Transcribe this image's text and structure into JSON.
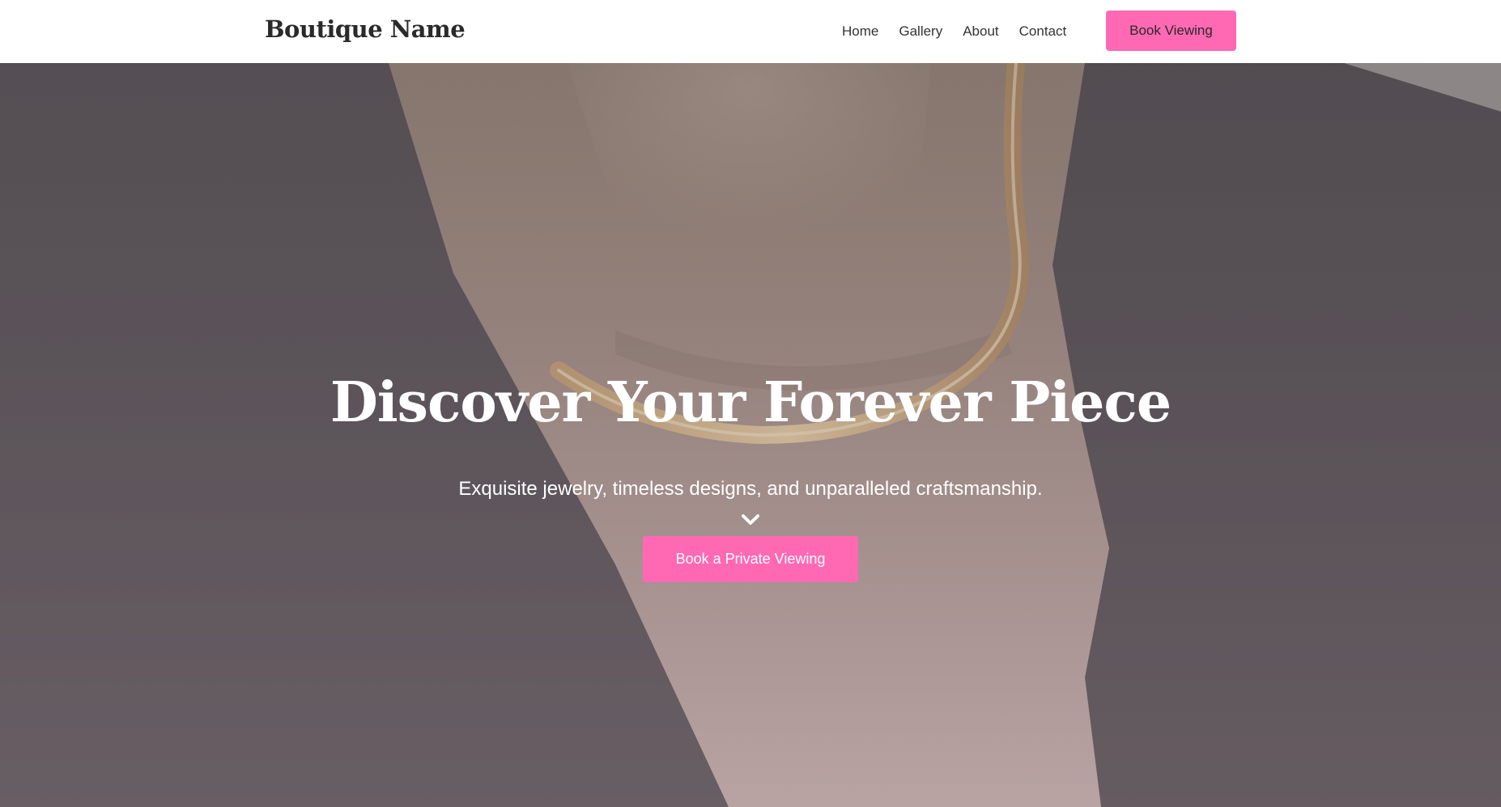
{
  "header": {
    "logo": "Boutique Name",
    "nav": [
      {
        "label": "Home"
      },
      {
        "label": "Gallery"
      },
      {
        "label": "About"
      },
      {
        "label": "Contact"
      }
    ],
    "cta_label": "Book Viewing"
  },
  "hero": {
    "title": "Discover Your Forever Piece",
    "subtitle": "Exquisite jewelry, timeless designs, and unparalleled craftsmanship.",
    "scroll_icon": "chevron-down-icon",
    "cta_label": "Book a Private Viewing"
  },
  "colors": {
    "accent": "#ff69b4",
    "header_bg": "#ffffff",
    "logo_text": "#2a2a2a",
    "hero_text": "#ffffff"
  }
}
